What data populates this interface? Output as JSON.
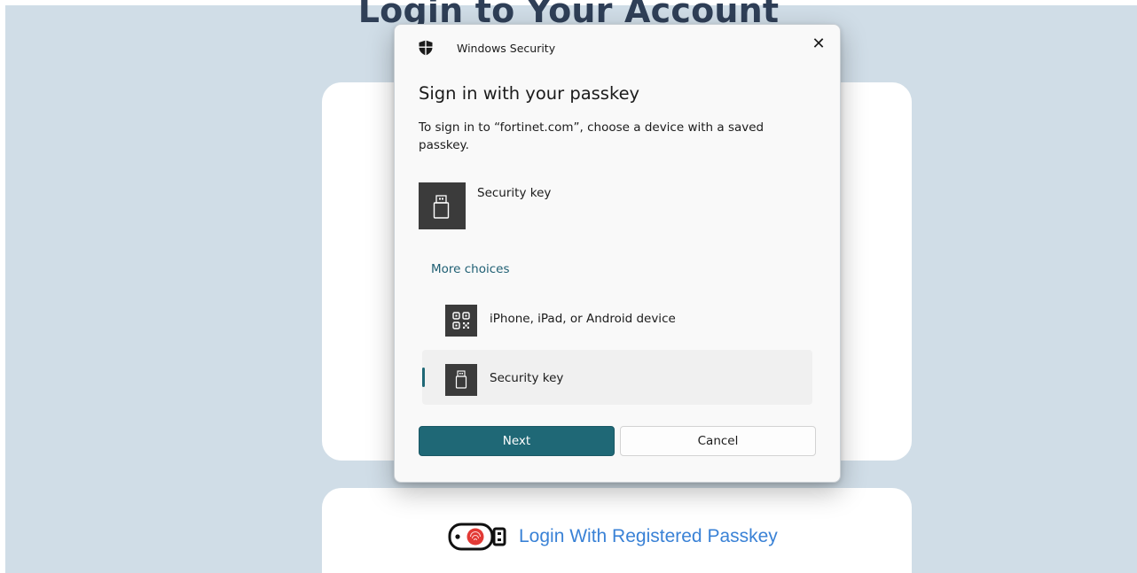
{
  "page": {
    "heading": "Login to Your Account",
    "passkey_link": "Login With Registered Passkey"
  },
  "dialog": {
    "app_title": "Windows Security",
    "heading": "Sign in with your passkey",
    "description": "To sign in to “fortinet.com”, choose a device with a saved passkey.",
    "primary_option": {
      "label": "Security key",
      "icon": "usb-security-key-icon"
    },
    "more_choices_label": "More choices",
    "choices": [
      {
        "label": "iPhone, iPad, or Android device",
        "icon": "qr-code-icon",
        "selected": false
      },
      {
        "label": "Security key",
        "icon": "usb-security-key-icon",
        "selected": true
      }
    ],
    "buttons": {
      "next": "Next",
      "cancel": "Cancel"
    }
  },
  "colors": {
    "page_background": "#d0dde7",
    "accent": "#1f6876",
    "link": "#3a82d6"
  }
}
